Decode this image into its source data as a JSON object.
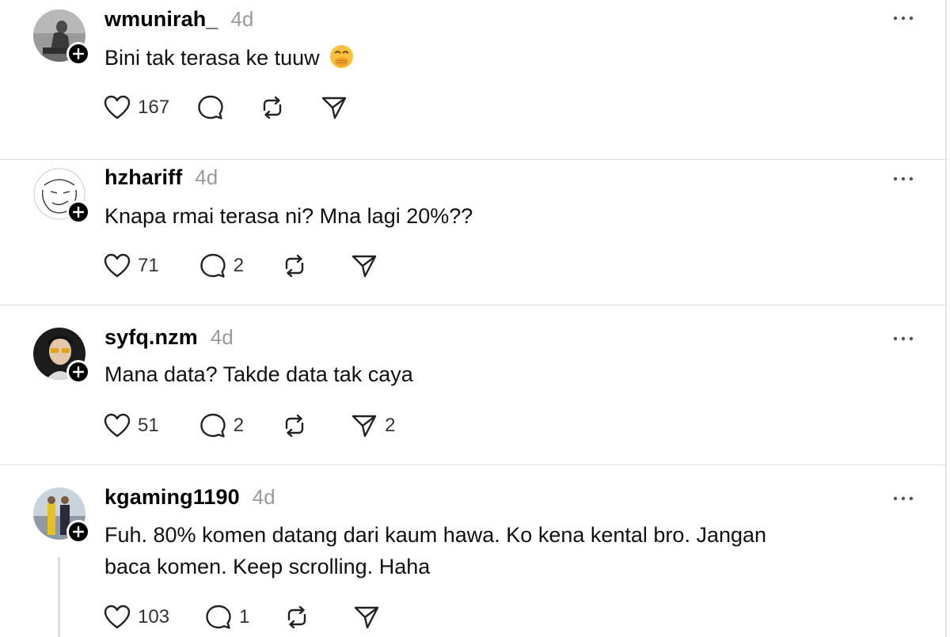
{
  "posts": [
    {
      "username": "wmunirah_",
      "time": "4d",
      "text": "Bini tak terasa ke tuuw",
      "emoji": "face-with-hand-over-mouth",
      "likes": "167",
      "replies": "",
      "reposts": "",
      "shares": ""
    },
    {
      "username": "hzhariff",
      "time": "4d",
      "text": "Knapa rmai terasa ni? Mna lagi 20%??",
      "likes": "71",
      "replies": "2",
      "reposts": "",
      "shares": ""
    },
    {
      "username": "syfq.nzm",
      "time": "4d",
      "text": "Mana data? Takde data tak caya",
      "likes": "51",
      "replies": "2",
      "reposts": "",
      "shares": "2"
    },
    {
      "username": "kgaming1190",
      "time": "4d",
      "text_line1": "Fuh. 80% komen datang dari kaum hawa. Ko kena kental bro. Jangan",
      "text_line2": "baca komen. Keep scrolling. Haha",
      "likes": "103",
      "replies": "1",
      "reposts": "",
      "shares": ""
    }
  ],
  "icons": {
    "like": "heart-icon",
    "reply": "comment-icon",
    "repost": "repost-icon",
    "share": "send-icon",
    "more": "more-icon",
    "follow": "plus-icon"
  },
  "colors": {
    "text": "#000000",
    "muted": "#999999",
    "divider": "#dedede",
    "follow_badge": "#000000"
  }
}
